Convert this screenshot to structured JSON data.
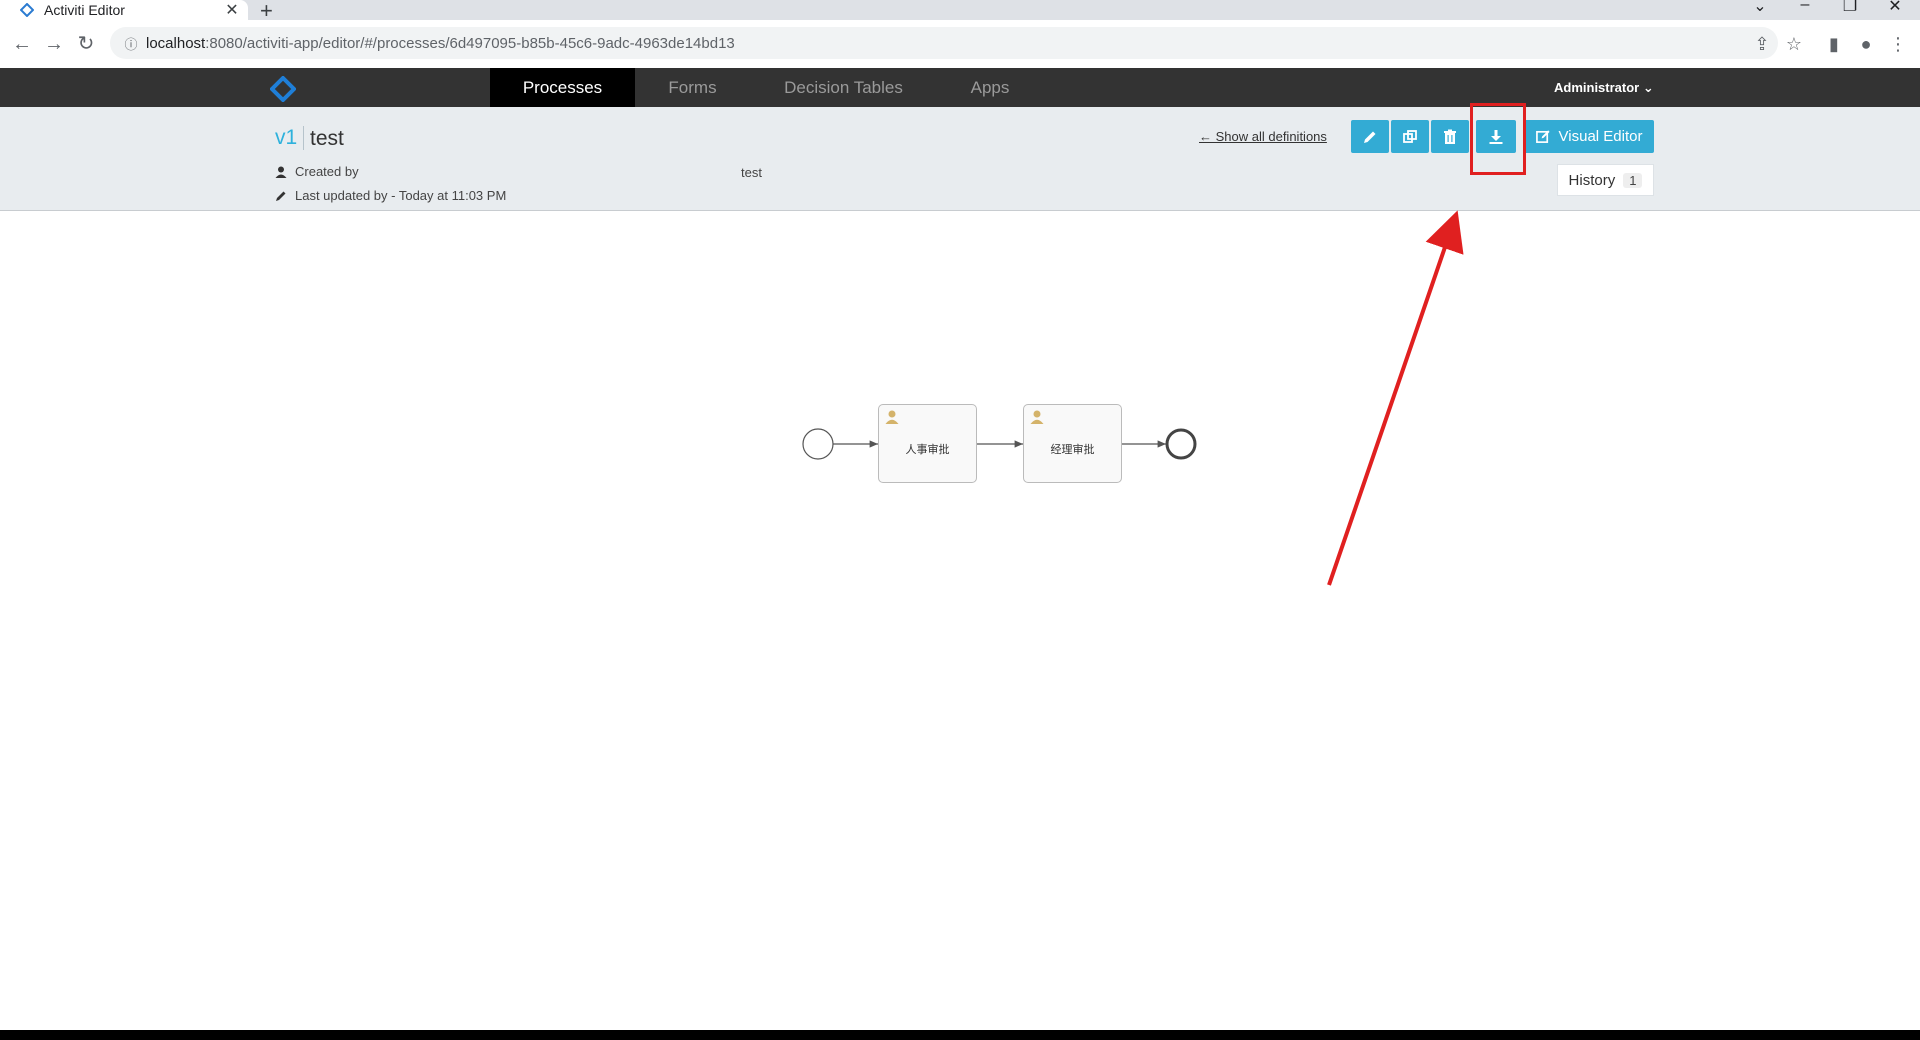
{
  "browser": {
    "tab_title": "Activiti Editor",
    "tab_close": "✕",
    "new_tab": "+",
    "url_host": "localhost",
    "url_rest": ":8080/activiti-app/editor/#/processes/6d497095-b85b-45c6-9adc-4963de14bd13"
  },
  "appnav": {
    "tabs": [
      {
        "label": "Processes",
        "active": true
      },
      {
        "label": "Forms",
        "active": false
      },
      {
        "label": "Decision Tables",
        "active": false
      },
      {
        "label": "Apps",
        "active": false
      }
    ],
    "user_label": "Administrator"
  },
  "header": {
    "version": "v1",
    "title": "test",
    "created_by_label": "Created by",
    "created_by_value": "test",
    "last_updated": "Last updated by - Today at 11:03 PM",
    "show_all_link": "← Show all definitions",
    "visual_editor_label": "Visual Editor",
    "history_label": "History",
    "history_count": "1"
  },
  "diagram": {
    "tasks": [
      "人事审批",
      "经理审批"
    ]
  },
  "colors": {
    "accent": "#33abd4",
    "navbar": "#333333",
    "annotation": "#e02020"
  }
}
